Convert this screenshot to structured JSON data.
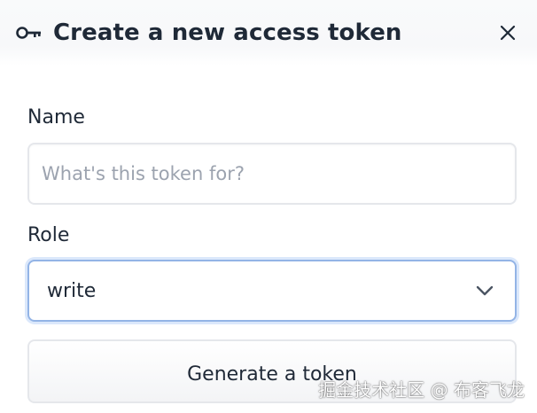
{
  "dialog": {
    "title": "Create a new access token",
    "title_icon": "key-icon",
    "close_icon": "close-icon"
  },
  "form": {
    "name_label": "Name",
    "name_value": "",
    "name_placeholder": "What's this token for?",
    "role_label": "Role",
    "role_value": "write",
    "role_icon": "chevron-down-icon",
    "submit_label": "Generate a token"
  },
  "watermark": {
    "text": "掘金技术社区 @ 布客飞龙"
  },
  "colors": {
    "text": "#1f2937",
    "placeholder": "#9ca3af",
    "border": "#e5e7eb",
    "focus_border": "#93b4e6",
    "focus_ring": "#dbe8fb",
    "header_bg": "#f9fafb"
  }
}
